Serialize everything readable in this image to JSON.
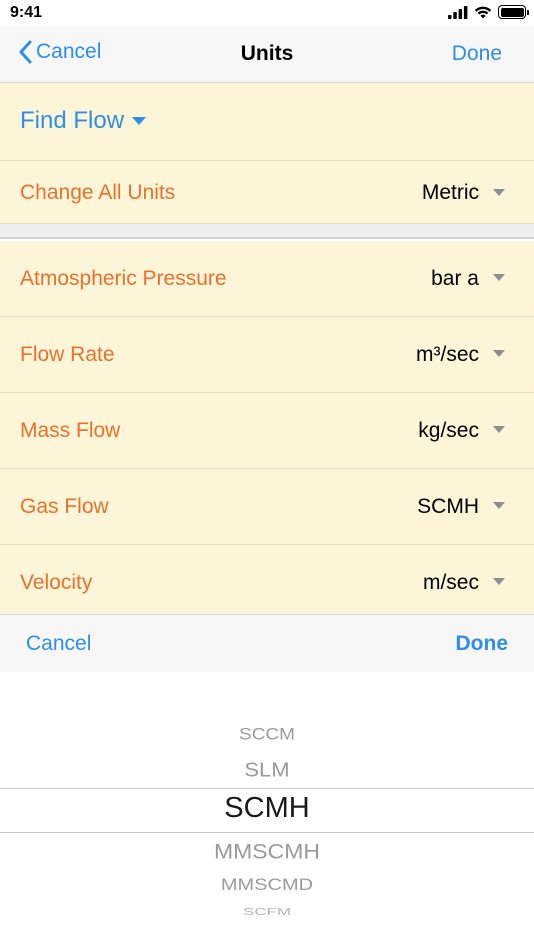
{
  "status": {
    "time": "9:41"
  },
  "nav": {
    "cancel_label": "Cancel",
    "title": "Units",
    "done_label": "Done"
  },
  "find_flow": {
    "label": "Find Flow"
  },
  "change_all": {
    "label": "Change All Units",
    "value": "Metric"
  },
  "units": [
    {
      "label": "Atmospheric Pressure",
      "value": "bar a"
    },
    {
      "label": "Flow Rate",
      "value": "m³/sec"
    },
    {
      "label": "Mass Flow",
      "value": "kg/sec"
    },
    {
      "label": "Gas Flow",
      "value": "SCMH"
    },
    {
      "label": "Velocity",
      "value": "m/sec"
    }
  ],
  "toolbar": {
    "cancel_label": "Cancel",
    "done_label": "Done"
  },
  "picker": {
    "options": [
      "SCCM",
      "SLM",
      "SCMH",
      "MMSCMH",
      "MMSCMD",
      "SCFM"
    ],
    "selected": "SCMH"
  },
  "colors": {
    "accent": "#2f8ee6",
    "label_orange": "#e9712b",
    "cream_background": "#fdf5d8"
  }
}
